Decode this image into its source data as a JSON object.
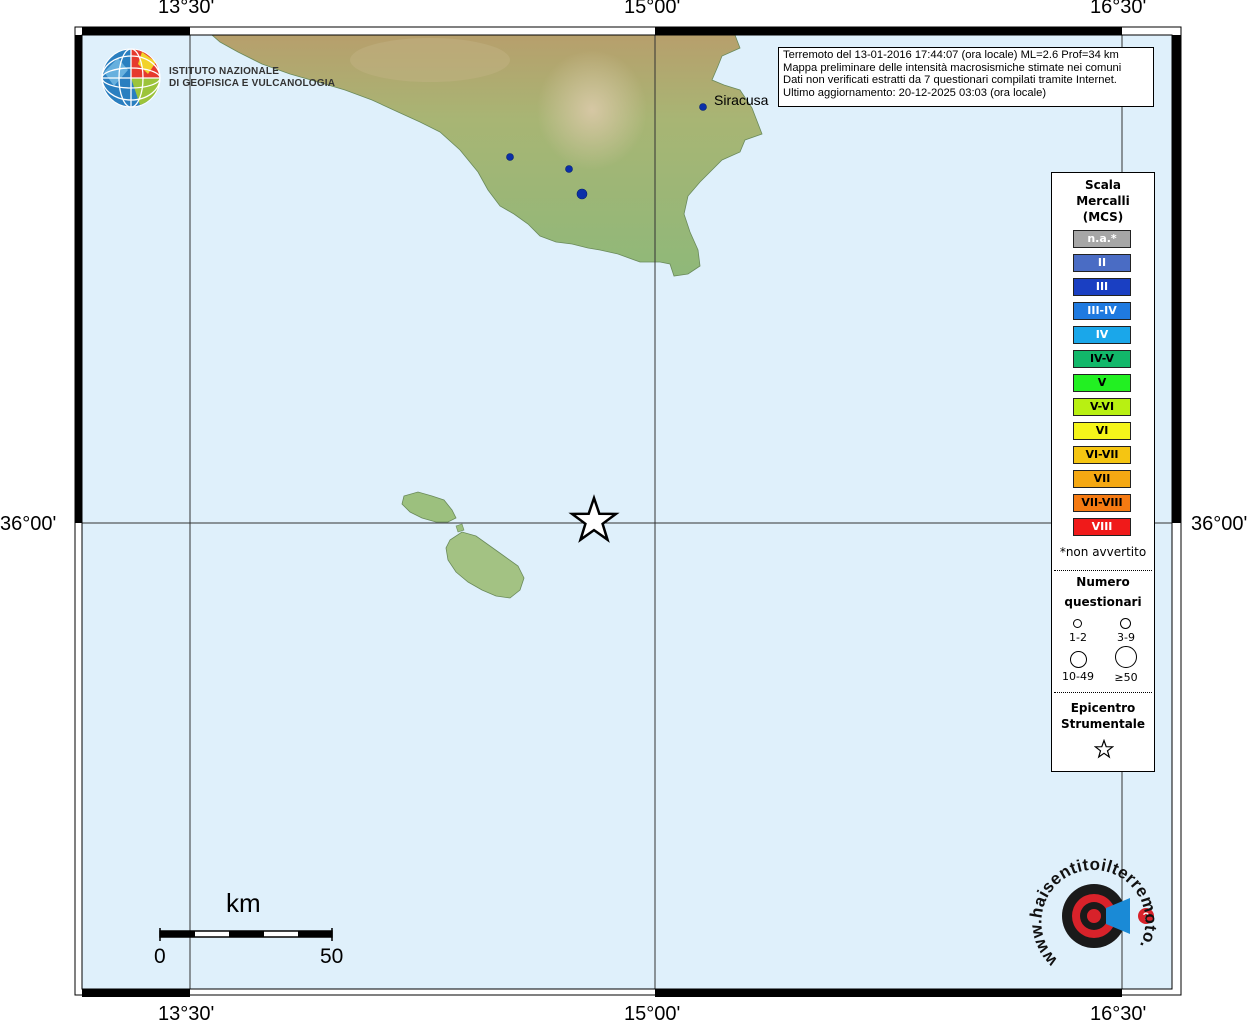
{
  "info": {
    "line1": "Terremoto del 13-01-2016 17:44:07 (ora locale) ML=2.6 Prof=34 km",
    "line2": "Mappa preliminare delle intensità macrosismiche stimate nei comuni",
    "line3": "Dati non verificati estratti da 7 questionari compilati tramite Internet.",
    "line4": "Ultimo aggiornamento: 20-12-2025 03:03 (ora locale)"
  },
  "logo": {
    "line1": "ISTITUTO NAZIONALE",
    "line2": "DI GEOFISICA E VULCANOLOGIA"
  },
  "coords": {
    "top": [
      "13°30'",
      "15°00'",
      "16°30'"
    ],
    "bottom": [
      "13°30'",
      "15°00'",
      "16°30'"
    ],
    "left": "36°00'",
    "right": "36°00'"
  },
  "places": {
    "siracusa": "Siracusa"
  },
  "scalebar": {
    "unit": "km",
    "start": "0",
    "end": "50"
  },
  "legend": {
    "title": "Scala\nMercalli\n(MCS)",
    "items": [
      {
        "label": "n.a.*",
        "color": "#a6a6a6",
        "text": "#ffffff"
      },
      {
        "label": "II",
        "color": "#4a6cc4",
        "text": "#ffffff"
      },
      {
        "label": "III",
        "color": "#1a3fc2",
        "text": "#ffffff"
      },
      {
        "label": "III-IV",
        "color": "#1f7ae0",
        "text": "#ffffff"
      },
      {
        "label": "IV",
        "color": "#1aa7ea",
        "text": "#ffffff"
      },
      {
        "label": "IV-V",
        "color": "#12b86a",
        "text": "#000000"
      },
      {
        "label": "V",
        "color": "#22f022",
        "text": "#000000"
      },
      {
        "label": "V-VI",
        "color": "#b8f012",
        "text": "#000000"
      },
      {
        "label": "VI",
        "color": "#f5f51a",
        "text": "#000000"
      },
      {
        "label": "VI-VII",
        "color": "#f5c512",
        "text": "#000000"
      },
      {
        "label": "VII",
        "color": "#f5a812",
        "text": "#000000"
      },
      {
        "label": "VII-VIII",
        "color": "#f57a12",
        "text": "#000000"
      },
      {
        "label": "VIII",
        "color": "#f01a1a",
        "text": "#ffffff"
      }
    ],
    "note": "*non avvertito",
    "questionnaires_title": "Numero\nquestionari",
    "questionnaires": [
      "1-2",
      "3-9",
      "10-49",
      "≥50"
    ],
    "epicenter_title": "Epicentro\nStrumentale"
  },
  "watermark": {
    "text": "www.haisentitoilterremoto.it"
  },
  "colors": {
    "sea": "#dff0fb",
    "land": "#a9c58a",
    "point": "#0b2fa8",
    "frame": "#000000"
  }
}
